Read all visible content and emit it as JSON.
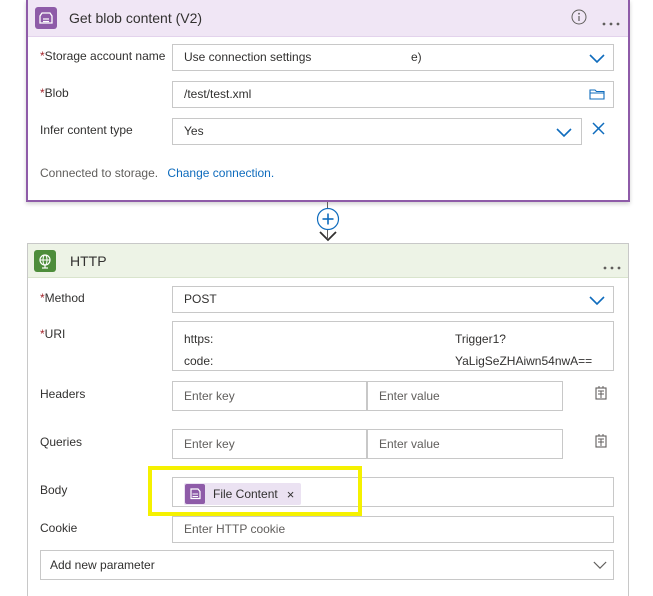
{
  "blob_action": {
    "title": "Get blob content (V2)",
    "fields": {
      "storage_account": {
        "label": "Storage account name",
        "value_start": "Use connection settings",
        "value_end": "e)"
      },
      "blob": {
        "label": "Blob",
        "value": "/test/test.xml"
      },
      "infer_content_type": {
        "label": "Infer content type",
        "value": "Yes"
      }
    },
    "connected_text": "Connected to storage.",
    "change_connection": "Change connection."
  },
  "http_action": {
    "title": "HTTP",
    "method": {
      "label": "Method",
      "value": "POST"
    },
    "uri": {
      "label": "URI",
      "line1_start": "https:",
      "line1_end": "Trigger1?",
      "line2_start": "code:",
      "line2_end": "YaLigSeZHAiwn54nwA=="
    },
    "headers": {
      "label": "Headers",
      "key_placeholder": "Enter key",
      "value_placeholder": "Enter value"
    },
    "queries": {
      "label": "Queries",
      "key_placeholder": "Enter key",
      "value_placeholder": "Enter value"
    },
    "body": {
      "label": "Body",
      "token_label": "File Content",
      "token_remove": "×"
    },
    "cookie": {
      "label": "Cookie",
      "placeholder": "Enter HTTP cookie"
    },
    "add_parameter": "Add new parameter"
  },
  "colors": {
    "blob_accent": "#8e5ba8",
    "http_accent": "#4d8d3b",
    "link": "#0f6cbd",
    "highlight": "#f5f100"
  },
  "icons": {
    "blob": "blob-storage-icon",
    "http": "globe-icon",
    "info": "info-icon",
    "more": "more-options-icon",
    "chevron": "chevron-down-icon",
    "clear": "close-icon",
    "folder": "folder-icon",
    "add": "add-step-icon",
    "switch": "switch-to-text-mode-icon"
  }
}
